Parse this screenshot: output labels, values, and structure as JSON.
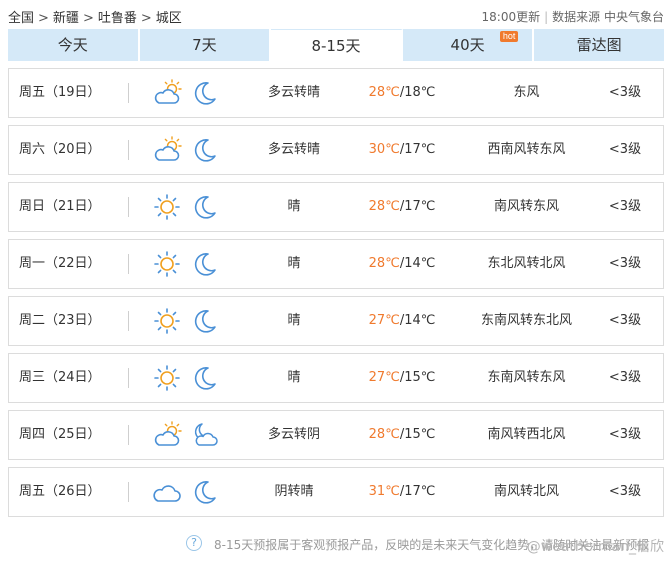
{
  "breadcrumb": {
    "items": [
      "全国",
      "新疆",
      "吐鲁番",
      "城区"
    ]
  },
  "meta": {
    "update_time": "18:00更新",
    "source_label": "数据来源 中央气象台"
  },
  "tabs": [
    {
      "label": "今天",
      "active": false
    },
    {
      "label": "7天",
      "active": false
    },
    {
      "label": "8-15天",
      "active": true
    },
    {
      "label": "40天",
      "active": false,
      "badge": "hot"
    },
    {
      "label": "雷达图",
      "active": false
    }
  ],
  "forecast": [
    {
      "day": "周五（19日）",
      "icon_day": "partly-cloudy-icon",
      "icon_night": "moon-icon",
      "desc": "多云转晴",
      "high": "28℃",
      "low": "/18℃",
      "wind": "东风",
      "level": "<3级"
    },
    {
      "day": "周六（20日）",
      "icon_day": "partly-cloudy-icon",
      "icon_night": "moon-icon",
      "desc": "多云转晴",
      "high": "30℃",
      "low": "/17℃",
      "wind": "西南风转东风",
      "level": "<3级"
    },
    {
      "day": "周日（21日）",
      "icon_day": "sun-icon",
      "icon_night": "moon-icon",
      "desc": "晴",
      "high": "28℃",
      "low": "/17℃",
      "wind": "南风转东风",
      "level": "<3级"
    },
    {
      "day": "周一（22日）",
      "icon_day": "sun-icon",
      "icon_night": "moon-icon",
      "desc": "晴",
      "high": "28℃",
      "low": "/14℃",
      "wind": "东北风转北风",
      "level": "<3级"
    },
    {
      "day": "周二（23日）",
      "icon_day": "sun-icon",
      "icon_night": "moon-icon",
      "desc": "晴",
      "high": "27℃",
      "low": "/14℃",
      "wind": "东南风转东北风",
      "level": "<3级"
    },
    {
      "day": "周三（24日）",
      "icon_day": "sun-icon",
      "icon_night": "moon-icon",
      "desc": "晴",
      "high": "27℃",
      "low": "/15℃",
      "wind": "东南风转东风",
      "level": "<3级"
    },
    {
      "day": "周四（25日）",
      "icon_day": "partly-cloudy-icon",
      "icon_night": "cloudy-moon-icon",
      "desc": "多云转阴",
      "high": "28℃",
      "low": "/15℃",
      "wind": "南风转西北风",
      "level": "<3级"
    },
    {
      "day": "周五（26日）",
      "icon_day": "cloud-icon",
      "icon_night": "moon-icon",
      "desc": "阴转晴",
      "high": "31℃",
      "low": "/17℃",
      "wind": "南风转北风",
      "level": "<3级"
    }
  ],
  "footer": {
    "help_glyph": "?",
    "note": "8-15天预报属于客观预报产品，反映的是未来天气变化趋势，请随时关注最新预报",
    "watermark": "@weatherman_信欣"
  },
  "colors": {
    "tab_bg": "#d5e9f8",
    "high_temp": "#f07a2e",
    "icon_blue": "#4a90d6",
    "icon_orange": "#f0a020"
  }
}
